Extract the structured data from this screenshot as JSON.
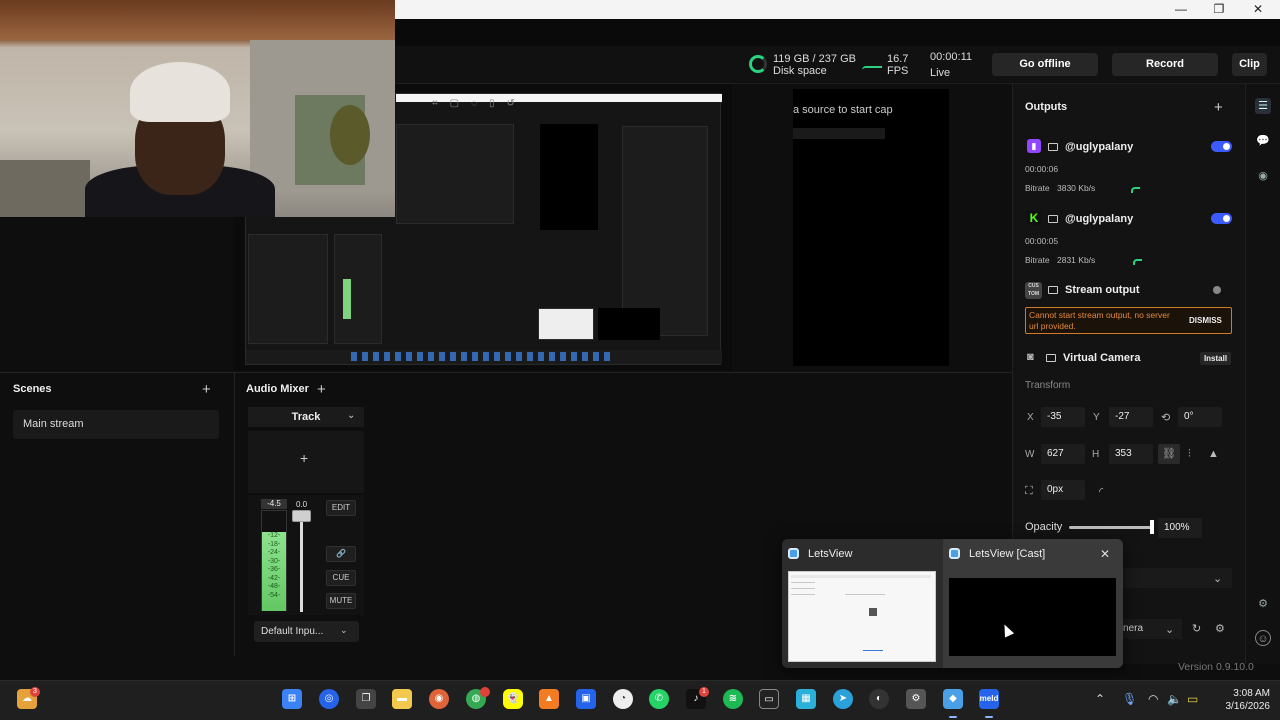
{
  "header": {
    "disk_value": "119 GB / 237 GB",
    "disk_label": "Disk space",
    "fps_value": "16.7",
    "fps_label": "FPS",
    "time_value": "00:00:11",
    "time_label": "Live",
    "go_offline_label": "Go offline",
    "record_label": "Record",
    "clip_label": "Clip",
    "accent_green": "#2bd17e"
  },
  "preview": {
    "source_hint": "a source to start cap"
  },
  "scenes": {
    "title": "Scenes",
    "items": [
      "Main stream"
    ]
  },
  "audio_mixer": {
    "title": "Audio Mixer",
    "track_label": "Track",
    "level_db": "-4.5",
    "fader_db": "0.0",
    "ticks": [
      "-12-",
      "-18-",
      "-24-",
      "-30-",
      "-36-",
      "-42-",
      "-48-",
      "-54-"
    ],
    "edit_label": "EDIT",
    "cue_label": "CUE",
    "mute_label": "MUTE",
    "input_label": "Default Inpu..."
  },
  "outputs": {
    "title": "Outputs",
    "items": [
      {
        "name": "@uglypalany",
        "time": "00:00:06",
        "bitrate_label": "Bitrate",
        "bitrate": "3830 Kb/s",
        "enabled": true,
        "platform_icon": "twitch-icon",
        "color": "#9146ff"
      },
      {
        "name": "@uglypalany",
        "time": "00:00:05",
        "bitrate_label": "Bitrate",
        "bitrate": "2831 Kb/s",
        "enabled": true,
        "platform_icon": "kick-icon",
        "color": "#53fc18"
      }
    ],
    "stream_output": {
      "icon_text": "CUS TOM",
      "name": "Stream output",
      "error": "Cannot start stream output, no server url provided.",
      "dismiss_label": "DISMISS"
    },
    "virtual_camera": {
      "name": "Virtual Camera",
      "install_label": "Install"
    }
  },
  "transform": {
    "title": "Transform",
    "x_label": "X",
    "x": "-35",
    "y_label": "Y",
    "y": "-27",
    "rotation": "0°",
    "w_label": "W",
    "w": "627",
    "h_label": "H",
    "h": "353",
    "border": "0px",
    "opacity_label": "Opacity",
    "opacity": "100%",
    "opacity_fraction": 1.0,
    "camera_select": "nera"
  },
  "version": "Version 0.9.10.0",
  "taskbar_popup": {
    "items": [
      {
        "title": "LetsView"
      },
      {
        "title": "LetsView [Cast]"
      }
    ]
  },
  "taskbar": {
    "weather_badge": "3",
    "tiktok_badge": "1",
    "time": "3:08 AM",
    "date": "3/16/2026",
    "meld_label": "meld"
  }
}
